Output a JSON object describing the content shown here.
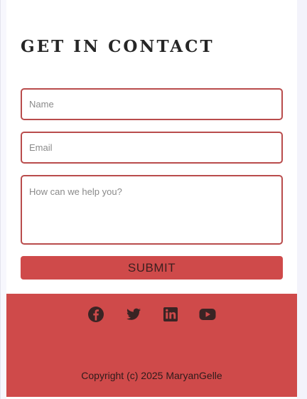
{
  "contact": {
    "title": "GET IN CONTACT",
    "name_placeholder": "Name",
    "email_placeholder": "Email",
    "message_placeholder": "How can we help you?",
    "submit_label": "SUBMIT"
  },
  "footer": {
    "social_icons": [
      "facebook-icon",
      "twitter-icon",
      "linkedin-icon",
      "youtube-icon"
    ],
    "copyright": "Copyright (c) 2025 MaryanGelle"
  },
  "colors": {
    "accent": "#cf4a4a",
    "field_border": "#b94c4c",
    "icon": "#3a2424"
  }
}
